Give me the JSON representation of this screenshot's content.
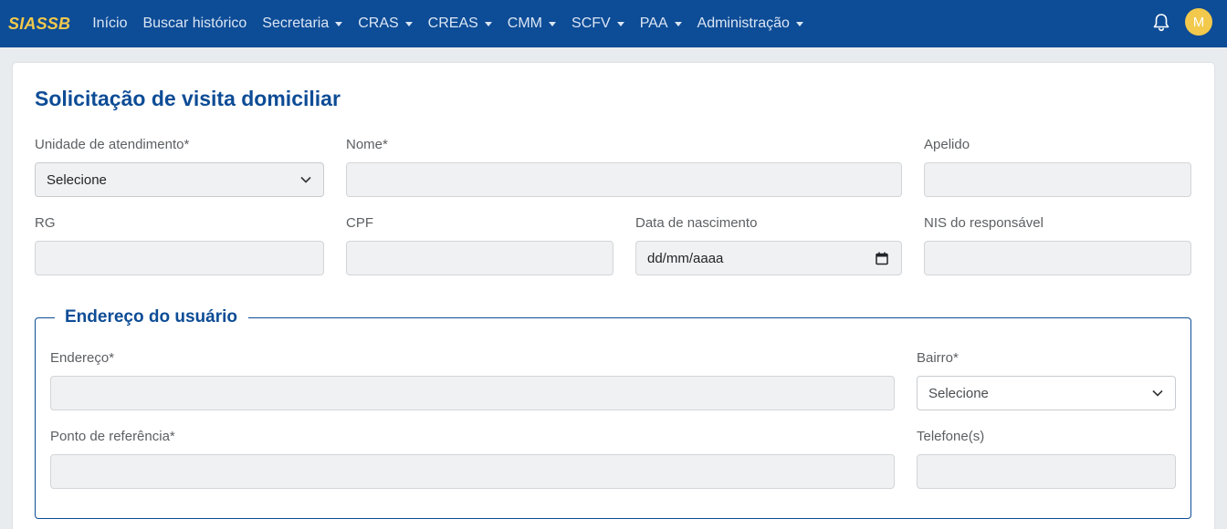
{
  "nav": {
    "brand": "SIASSB",
    "items": [
      {
        "label": "Início",
        "dropdown": false
      },
      {
        "label": "Buscar histórico",
        "dropdown": false
      },
      {
        "label": "Secretaria",
        "dropdown": true
      },
      {
        "label": "CRAS",
        "dropdown": true
      },
      {
        "label": "CREAS",
        "dropdown": true
      },
      {
        "label": "CMM",
        "dropdown": true
      },
      {
        "label": "SCFV",
        "dropdown": true
      },
      {
        "label": "PAA",
        "dropdown": true
      },
      {
        "label": "Administração",
        "dropdown": true
      }
    ],
    "avatar_initial": "M",
    "bell_icon": "bell-icon",
    "brand_color": "#0d4c96",
    "accent_color": "#f2c94c"
  },
  "form": {
    "title": "Solicitação de visita domiciliar",
    "unidade_label": "Unidade de atendimento*",
    "unidade_value": "Selecione",
    "nome_label": "Nome*",
    "apelido_label": "Apelido",
    "rg_label": "RG",
    "cpf_label": "CPF",
    "nascimento_label": "Data de nascimento",
    "nascimento_placeholder": "dd/mm/aaaa",
    "nis_label": "NIS do responsável"
  },
  "address": {
    "legend": "Endereço do usuário",
    "endereco_label": "Endereço*",
    "bairro_label": "Bairro*",
    "bairro_value": "Selecione",
    "referencia_label": "Ponto de referência*",
    "telefone_label": "Telefone(s)"
  }
}
